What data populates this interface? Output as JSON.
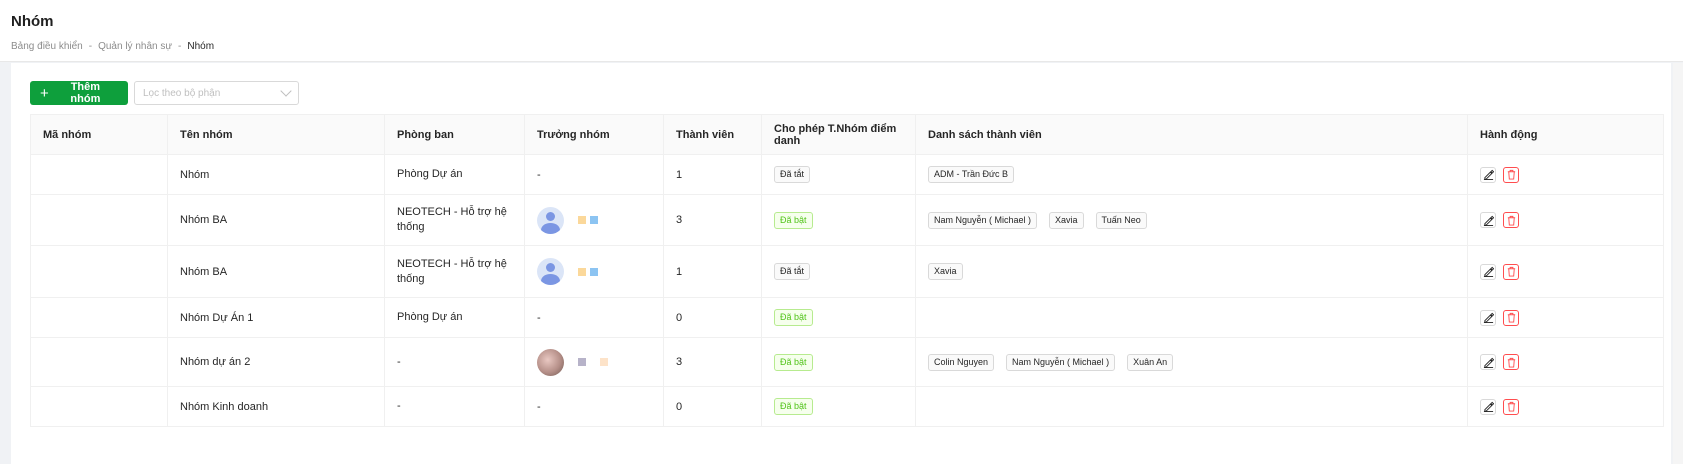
{
  "header": {
    "title": "Nhóm",
    "breadcrumb": [
      "Bảng điều khiển",
      "Quản lý nhân sự",
      "Nhóm"
    ],
    "breadcrumb_sep": "-"
  },
  "toolbar": {
    "add_label": "Thêm nhóm",
    "add_icon": "plus-icon",
    "filter_placeholder": "Lọc theo bộ phận"
  },
  "table": {
    "columns": [
      "Mã nhóm",
      "Tên nhóm",
      "Phòng ban",
      "Trưởng nhóm",
      "Thành viên",
      "Cho phép T.Nhóm điểm danh",
      "Danh sách thành viên",
      "Hành động"
    ],
    "rows": [
      {
        "code": "",
        "name": "Nhóm",
        "dept": "Phòng Dự án",
        "leader": "-",
        "leader_avatar": "",
        "count": "1",
        "attendance": "Đã tắt",
        "attendance_on": false,
        "members": [
          "ADM - Trần Đức B"
        ]
      },
      {
        "code": "",
        "name": "Nhóm BA",
        "dept": "NEOTECH - Hỗ trợ hệ thống",
        "leader": "",
        "leader_avatar": "user-icon",
        "count": "3",
        "attendance": "Đã bật",
        "attendance_on": true,
        "members": [
          "Nam Nguyễn ( Michael )",
          "Xavia",
          "Tuấn Neo"
        ]
      },
      {
        "code": "",
        "name": "Nhóm BA",
        "dept": "NEOTECH - Hỗ trợ hệ thống",
        "leader": "",
        "leader_avatar": "user-icon",
        "count": "1",
        "attendance": "Đã tắt",
        "attendance_on": false,
        "members": [
          "Xavia"
        ]
      },
      {
        "code": "",
        "name": "Nhóm Dự Án 1",
        "dept": "Phòng Dự án",
        "leader": "-",
        "leader_avatar": "",
        "count": "0",
        "attendance": "Đã bật",
        "attendance_on": true,
        "members": []
      },
      {
        "code": "",
        "name": "Nhóm dự án 2",
        "dept": "-",
        "leader": "",
        "leader_avatar": "photo",
        "count": "3",
        "attendance": "Đã bật",
        "attendance_on": true,
        "members": [
          "Colin Nguyen",
          "Nam Nguyễn ( Michael )",
          "Xuân An"
        ]
      },
      {
        "code": "",
        "name": "Nhóm Kinh doanh",
        "dept": "-",
        "leader": "-",
        "leader_avatar": "",
        "count": "0",
        "attendance": "Đã bật",
        "attendance_on": true,
        "members": []
      }
    ]
  },
  "colors": {
    "primary": "#0e9f3c",
    "danger": "#ff4d4f",
    "tag_on": "#52c41a"
  }
}
